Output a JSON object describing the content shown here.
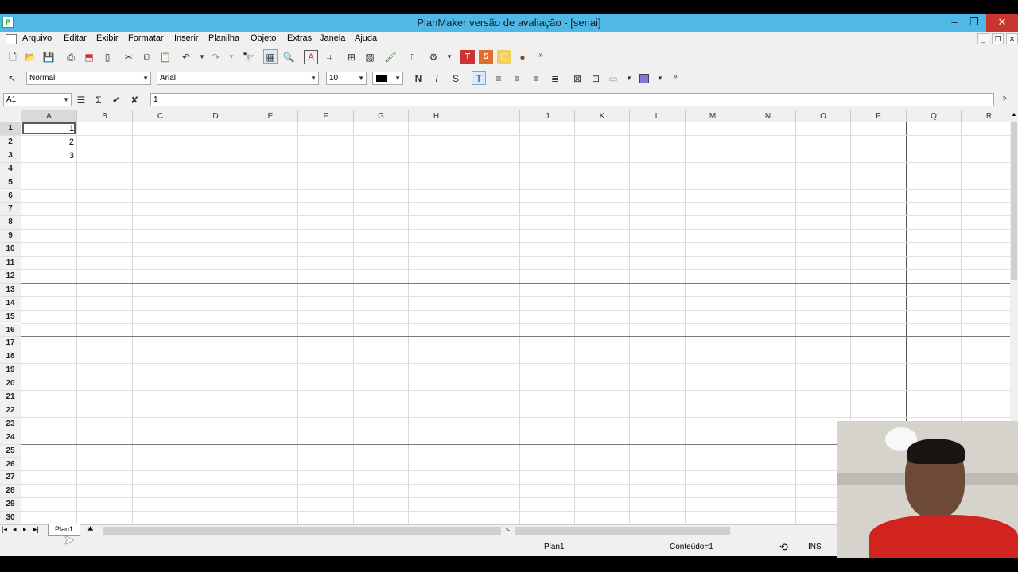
{
  "window": {
    "title": "PlanMaker versão de avaliação - [senai]"
  },
  "menu": [
    "Arquivo",
    "Editar",
    "Exibir",
    "Formatar",
    "Inserir",
    "Planilha",
    "Objeto",
    "Extras",
    "Janela",
    "Ajuda"
  ],
  "format_toolbar": {
    "style": "Normal",
    "font": "Arial",
    "size": "10"
  },
  "formula_bar": {
    "cell_ref": "A1",
    "content": "1"
  },
  "columns": [
    "A",
    "B",
    "C",
    "D",
    "E",
    "F",
    "G",
    "H",
    "I",
    "J",
    "K",
    "L",
    "M",
    "N",
    "O",
    "P",
    "Q",
    "R"
  ],
  "rows": [
    "1",
    "2",
    "3",
    "4",
    "5",
    "6",
    "7",
    "8",
    "9",
    "10",
    "11",
    "12",
    "13",
    "14",
    "15",
    "16",
    "17",
    "18",
    "19",
    "20",
    "21",
    "22",
    "23",
    "24",
    "25",
    "26",
    "27",
    "28",
    "29",
    "30"
  ],
  "cells": {
    "A1": "1",
    "A2": "2",
    "A3": "3"
  },
  "sheet_tab": "Plan1",
  "status": {
    "sheet": "Plan1",
    "content": "Conteúdo=1",
    "mode": "INS"
  },
  "colors": {
    "titlebar": "#4fb8e6",
    "close_button": "#c7372f",
    "selection": "#5a5a5a"
  }
}
